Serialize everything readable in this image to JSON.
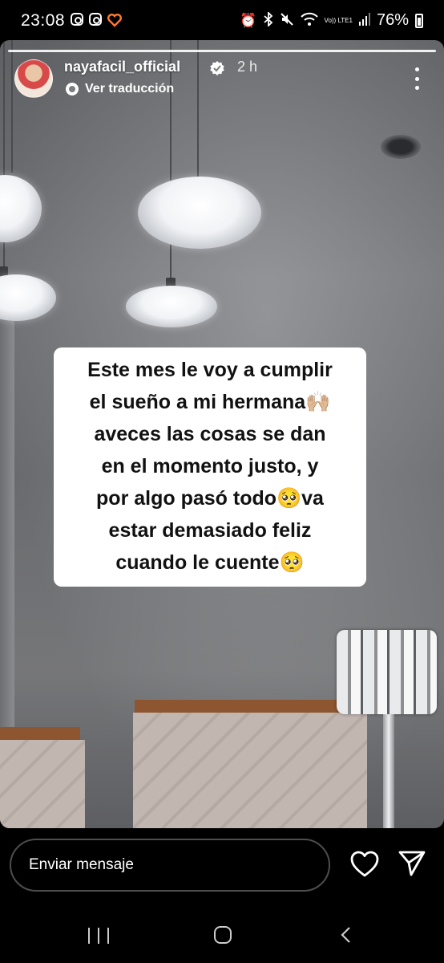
{
  "status_bar": {
    "time": "23:08",
    "battery": "76%",
    "network_label": "Vo)) LTE1"
  },
  "story": {
    "username": "nayafacil_official",
    "time_ago": "2 h",
    "translate_label": "Ver traducción",
    "caption_lines": [
      "Este mes le voy a cumplir",
      "el sueño a mi hermana🙌🏼",
      "aveces las cosas se dan",
      "en el momento justo, y",
      "por algo pasó todo🥺va",
      "estar demasiado feliz",
      "cuando le cuente🥺"
    ]
  },
  "bottom_bar": {
    "message_placeholder": "Enviar mensaje"
  },
  "colors": {
    "background": "#000000",
    "caption_bg": "#ffffff",
    "verified_badge": "#ffffff"
  },
  "icons": [
    "instagram-icon",
    "heart-app-icon",
    "alarm-icon",
    "bluetooth-icon",
    "mute-icon",
    "wifi-icon",
    "signal-icon",
    "battery-icon",
    "verified-icon",
    "translate-icon",
    "more-icon",
    "like-icon",
    "send-icon",
    "recents-icon",
    "home-icon",
    "back-icon"
  ]
}
